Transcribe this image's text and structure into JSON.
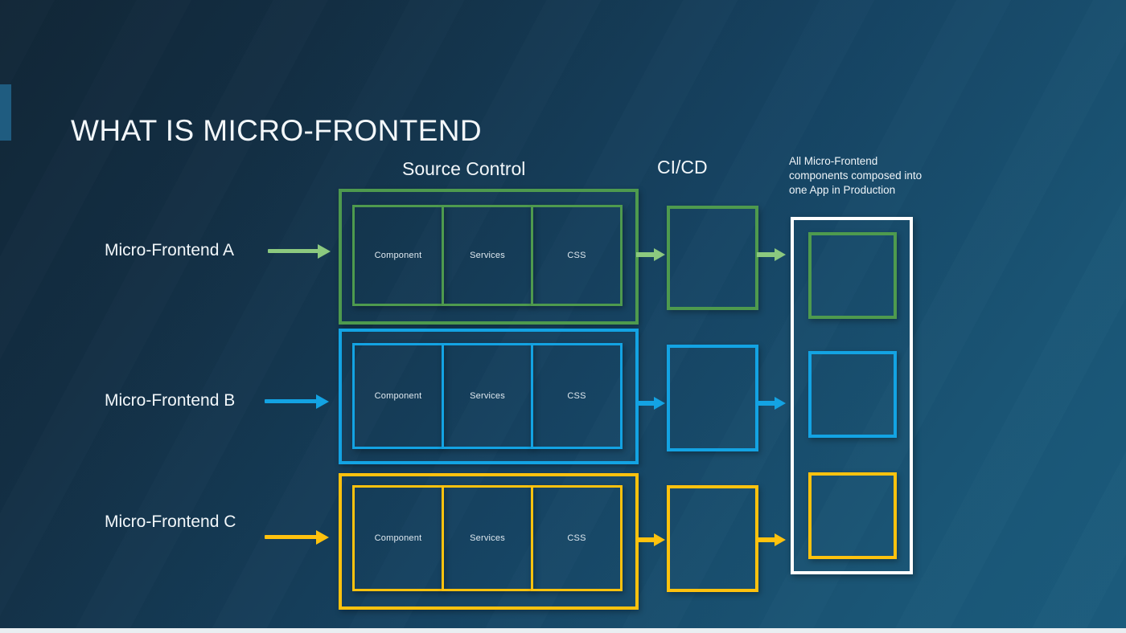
{
  "slide": {
    "title": "WHAT IS MICRO-FRONTEND",
    "background_start": "#112637",
    "background_end": "#1b5c7d",
    "accent_bar_color": "#1f5c80"
  },
  "headers": {
    "source_control": "Source Control",
    "cicd": "CI/CD"
  },
  "production_note": {
    "line1": "All Micro-Frontend",
    "line2": "components composed into",
    "line3": "one App in Production",
    "panel_border_color": "#ffffff"
  },
  "rows": [
    {
      "label": "Micro-Frontend A",
      "color": "#4e9a4e",
      "arrow_color": "#8cc97f",
      "boxes": [
        "Component",
        "Services",
        "CSS"
      ]
    },
    {
      "label": "Micro-Frontend B",
      "color": "#13a3e3",
      "arrow_color": "#13a3e3",
      "boxes": [
        "Component",
        "Services",
        "CSS"
      ]
    },
    {
      "label": "Micro-Frontend C",
      "color": "#ffc20e",
      "arrow_color": "#ffc20e",
      "boxes": [
        "Component",
        "Services",
        "CSS"
      ]
    }
  ]
}
